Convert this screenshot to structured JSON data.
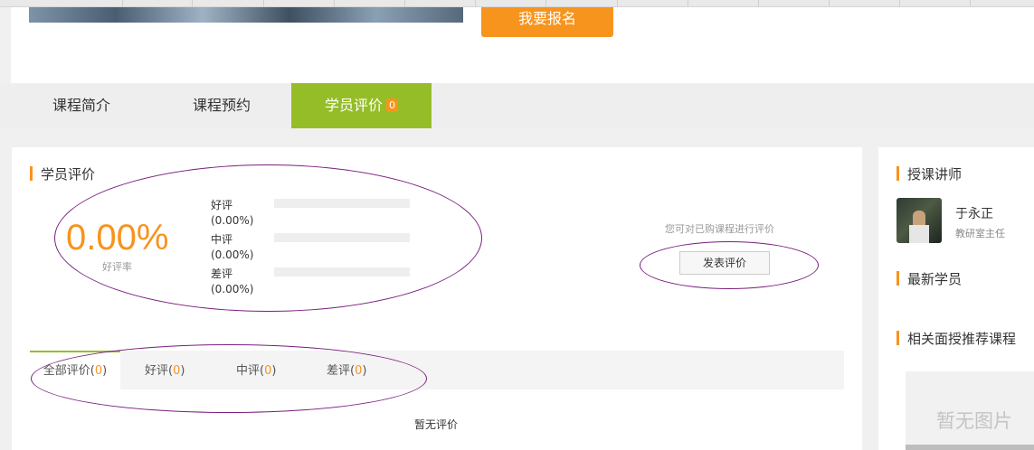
{
  "header": {
    "signup_button": "我要报名"
  },
  "tabs": {
    "intro": "课程简介",
    "booking": "课程预约",
    "review": "学员评价",
    "review_count": "0"
  },
  "review_section": {
    "title": "学员评价",
    "positive_rate": "0.00%",
    "positive_rate_label": "好评率",
    "distribution": [
      {
        "label": "好评",
        "percent": "(0.00%)",
        "fill": 0
      },
      {
        "label": "中评",
        "percent": "(0.00%)",
        "fill": 0
      },
      {
        "label": "差评",
        "percent": "(0.00%)",
        "fill": 0
      }
    ],
    "can_review_text": "您可对已购课程进行评价",
    "post_button": "发表评价",
    "filters": {
      "all": "全部评价",
      "all_count": "0",
      "good": "好评",
      "good_count": "0",
      "mid": "中评",
      "mid_count": "0",
      "bad": "差评",
      "bad_count": "0"
    },
    "empty_text": "暂无评价"
  },
  "sidebar": {
    "teacher_title": "授课讲师",
    "teacher_name": "于永正",
    "teacher_role": "教研室主任",
    "new_students_title": "最新学员",
    "related_title": "相关面授推荐课程",
    "no_image_text": "暂无图片"
  },
  "colors": {
    "accent": "#f7941d",
    "active_tab": "#95bd27",
    "annotation": "#7a1f7e"
  }
}
